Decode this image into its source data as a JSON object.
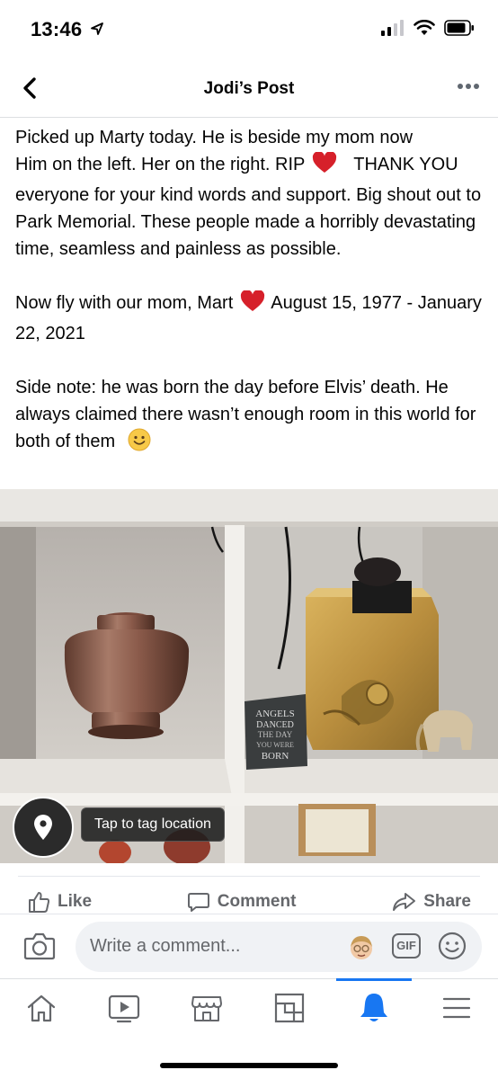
{
  "status_bar": {
    "time": "13:46",
    "icons": [
      "location-arrow-icon",
      "cellular-signal-icon",
      "wifi-icon",
      "battery-icon"
    ]
  },
  "header": {
    "title": "Jodi’s Post",
    "back_icon": "chevron-left-icon",
    "more_icon": "more-dots-icon"
  },
  "post": {
    "paragraphs": [
      {
        "line1": "Picked up Marty today.  He is beside my mom now",
        "line2_before_heart": "Him on the left.  Her on the right.  RIP",
        "line2_after_heart": "THANK",
        "rest": "YOU everyone for your kind words and support. Big shout out to Park Memorial. These people made a horribly devastating time, seamless and painless as possible."
      },
      {
        "before_heart": "Now fly with our mom, Mart",
        "after_heart": "August 15, 1977 - January 22, 2021"
      },
      {
        "text": "Side note:  he was born the day before Elvis’ death. He always claimed there wasn’t enough room in this world for both of them"
      }
    ],
    "photo_sign_lines": [
      "ANGELS",
      "DANCED",
      "THE DAY",
      "YOU WERE",
      "BORN"
    ],
    "tag_location_label": "Tap to tag location"
  },
  "actions": {
    "like": "Like",
    "comment": "Comment",
    "share": "Share"
  },
  "composer": {
    "placeholder": "Write a comment...",
    "gif_label": "GIF"
  },
  "tabbar": {
    "tabs": [
      "home-icon",
      "watch-icon",
      "marketplace-icon",
      "pages-icon",
      "notifications-icon",
      "menu-icon"
    ],
    "active": "notifications-icon"
  },
  "colors": {
    "accent": "#1877f2",
    "heart": "#d6202a",
    "muted_text": "#65676b",
    "input_bg": "#f0f2f5"
  }
}
